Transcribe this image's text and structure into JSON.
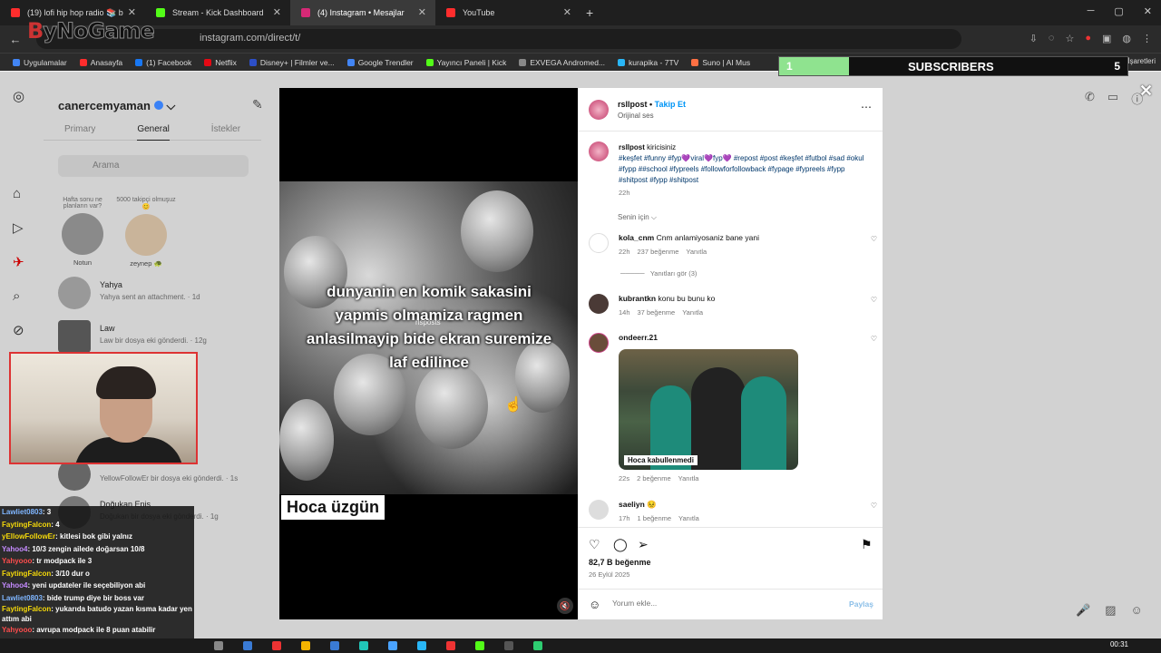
{
  "browser": {
    "tabs": [
      {
        "label": "(19) lofi hip hop radio 📚 b",
        "color": "#ff2d2d",
        "active": false
      },
      {
        "label": "Stream - Kick Dashboard",
        "color": "#53fc18",
        "active": false
      },
      {
        "label": "(4) Instagram • Mesajlar",
        "color": "#d62976",
        "active": true
      },
      {
        "label": "YouTube",
        "color": "#ff2d2d",
        "active": false
      }
    ],
    "url": "instagram.com/direct/t/",
    "logo_red": "B",
    "logo_rest": "yNoGame",
    "bookmarks": [
      {
        "label": "Uygulamalar",
        "color": "#4285f4"
      },
      {
        "label": "Anasayfa",
        "color": "#ff2d2d"
      },
      {
        "label": "(1) Facebook",
        "color": "#1877f2"
      },
      {
        "label": "Netflix",
        "color": "#e50914"
      },
      {
        "label": "Disney+ | Filmler ve...",
        "color": "#2d4fc7"
      },
      {
        "label": "Google Trendler",
        "color": "#4285f4"
      },
      {
        "label": "Yayıncı Paneli | Kick",
        "color": "#53fc18"
      },
      {
        "label": "EXVEGA Andromed...",
        "color": "#888888"
      },
      {
        "label": "kurapika - 7TV",
        "color": "#29b6f6"
      },
      {
        "label": "Suno | AI Mus",
        "color": "#ff7043"
      }
    ],
    "bookmarks_right": "Tüm Yer İşaretleri"
  },
  "subscribers": {
    "count": "1",
    "label": "SUBSCRIBERS",
    "goal": "5",
    "progress_fraction": 0.2,
    "fill_color": "#8fe38f"
  },
  "dm": {
    "username": "canercemyaman",
    "tabs": [
      "Primary",
      "General",
      "İstekler"
    ],
    "search_placeholder": "Arama",
    "notes": [
      {
        "note": "Hafta sonu ne planların var?",
        "name": "Notun"
      },
      {
        "note": "5000 takipçi olmuşuz 😊",
        "name": "zeynep 🐢"
      }
    ],
    "conversations": [
      {
        "name": "Yahya",
        "message": "Yahya sent an attachment. · 1d"
      },
      {
        "name": "Law",
        "message": "Law bir dosya eki gönderdi. · 12g"
      },
      {
        "name": "",
        "message": "YellowFollowEr bir dosya eki gönderdi. · 1s"
      },
      {
        "name": "Doğukan Enis",
        "message": "Doğukan bir dosya eki gönderdi. · 1g"
      }
    ]
  },
  "video": {
    "caption_lines": [
      "dunyanin en komik sakasini",
      "yapmis olmamiza ragmen",
      "anlasilmayip bide ekran suremize",
      "laf edilince"
    ],
    "watermark": "rlsposts",
    "title": "Hoca üzgün"
  },
  "post": {
    "author": "rsllpost",
    "follow_label": "Takip Et",
    "audio": "Orijinal ses",
    "caption_author": "rsllpost",
    "caption_text": "kiricisiniz",
    "caption_tags": "#keşfet #funny #fyp💜viral💜fyp💜 #repost #post #keşfet #futbol #sad #okul #fypp ##school #fypreels #followforfollowback #fypage #fypreels #fypp #shitpost #fypp #shitpost",
    "caption_time": "22h",
    "for_you": "Senin için ⌵",
    "comments": [
      {
        "user": "kola_cnm",
        "text": "Cnm anlamiyosaniz bane yani",
        "time": "22h",
        "likes": "237 beğenme",
        "reply": "Yanıtla"
      },
      {
        "user": "kubrantkn",
        "text": "konu bu bunu ko",
        "time": "14h",
        "likes": "37 beğenme",
        "reply": "Yanıtla"
      },
      {
        "user": "ondeerr.21",
        "text": "",
        "time": "22s",
        "likes": "2 beğenme",
        "reply": "Yanıtla"
      },
      {
        "user": "saeliyn",
        "text": "😣",
        "time": "17h",
        "likes": "1 beğenme",
        "reply": "Yanıtla"
      }
    ],
    "replies_label": "Yanıtları gör (3)",
    "comment_image_caption": "Hoca kabullenmedi",
    "likes": "82,7 B beğenme",
    "date": "26 Eylül 2025",
    "comment_placeholder": "Yorum ekle...",
    "share_label": "Paylaş"
  },
  "chat": [
    {
      "user": "Lawliet0803",
      "msg": ": 3",
      "color": "#7fb6ff"
    },
    {
      "user": "FaytingFalcon",
      "msg": ": 4",
      "color": "#f5d90a"
    },
    {
      "user": "yEllowFollowEr",
      "msg": ": kitlesi bok gibi yalnız",
      "color": "#f5d90a"
    },
    {
      "user": "Yahoo4",
      "msg": ": 10/3 zengin ailede doğarsan 10/8",
      "color": "#c58bff"
    },
    {
      "user": "Yahyooo",
      "msg": ": tr modpack ile 3",
      "color": "#ff4d4d"
    },
    {
      "user": "FaytingFalcon",
      "msg": ": 3/10 dur o",
      "color": "#f5d90a"
    },
    {
      "user": "Yahoo4",
      "msg": ": yeni updateler ile seçebiliyon abi",
      "color": "#c58bff"
    },
    {
      "user": "Lawliet0803",
      "msg": ": bide trump diye bir boss var",
      "color": "#7fb6ff"
    },
    {
      "user": "FaytingFalcon",
      "msg": ": yukarıda batudo yazan kısma kadar yen attım abi",
      "color": "#f5d90a"
    },
    {
      "user": "Yahyooo",
      "msg": ": avrupa modpack ile 8 puan atabilir",
      "color": "#ff4d4d"
    }
  ],
  "taskbar": {
    "time": "00:31"
  }
}
